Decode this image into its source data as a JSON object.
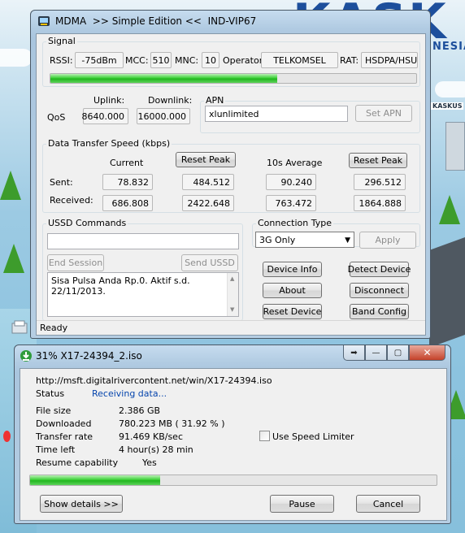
{
  "mdma": {
    "title": "MDMA  >> Simple Edition <<  IND-VIP67",
    "signal": {
      "group_label": "Signal",
      "rssi_label": "RSSI:",
      "rssi_value": "-75dBm",
      "mcc_label": "MCC:",
      "mcc_value": "510",
      "mnc_label": "MNC:",
      "mnc_value": "10",
      "operator_label": "Operator:",
      "operator_value": "TELKOMSEL",
      "rat_label": "RAT:",
      "rat_value": "HSDPA/HSUPA",
      "signal_level": 0.62
    },
    "qos": {
      "label": "QoS",
      "uplink_label": "Uplink:",
      "uplink_value": "8640.000",
      "downlink_label": "Downlink:",
      "downlink_value": "16000.000"
    },
    "apn": {
      "group_label": "APN",
      "value": "xlunlimited",
      "set_button": "Set APN"
    },
    "transfer": {
      "group_label": "Data Transfer Speed (kbps)",
      "current_label": "Current",
      "reset_peak_1": "Reset Peak",
      "avg_label": "10s Average",
      "reset_peak_2": "Reset Peak",
      "sent_label": "Sent:",
      "received_label": "Received:",
      "sent_current": "78.832",
      "sent_peak": "484.512",
      "sent_avg": "90.240",
      "sent_avg_peak": "296.512",
      "recv_current": "686.808",
      "recv_peak": "2422.648",
      "recv_avg": "763.472",
      "recv_avg_peak": "1864.888"
    },
    "ussd": {
      "group_label": "USSD Commands",
      "end_session": "End Session",
      "send_ussd": "Send USSD",
      "response": "Sisa Pulsa Anda Rp.0.  Aktif s.d. 22/11/2013."
    },
    "connection": {
      "group_label": "Connection Type",
      "selected": "3G Only",
      "apply": "Apply"
    },
    "buttons": {
      "device_info": "Device Info",
      "detect_device": "Detect Device",
      "about": "About",
      "disconnect": "Disconnect",
      "reset_device": "Reset Device",
      "band_config": "Band Config"
    },
    "status": "Ready"
  },
  "download": {
    "title": "31% X17-24394_2.iso",
    "url": "http://msft.digitalrivercontent.net/win/X17-24394.iso",
    "status_label": "Status",
    "status_value": "Receiving data...",
    "file_size_label": "File size",
    "file_size_value": "2.386  GB",
    "downloaded_label": "Downloaded",
    "downloaded_value": "780.223  MB  ( 31.92 % )",
    "rate_label": "Transfer rate",
    "rate_value": "91.469  KB/sec",
    "time_left_label": "Time left",
    "time_left_value": "4 hour(s) 28 min",
    "resume_label": "Resume capability",
    "resume_value": "Yes",
    "speed_limiter": "Use Speed Limiter",
    "progress": 0.3192,
    "show_details": "Show details >>",
    "pause": "Pause",
    "cancel": "Cancel"
  },
  "desktop": {
    "brand": "KASK",
    "tagline": "NESIA",
    "caption": "KASKUS"
  },
  "colors": {
    "progress_green": "#21b51f",
    "status_blue": "#0645ad",
    "brand_blue": "#1d4f9c"
  }
}
